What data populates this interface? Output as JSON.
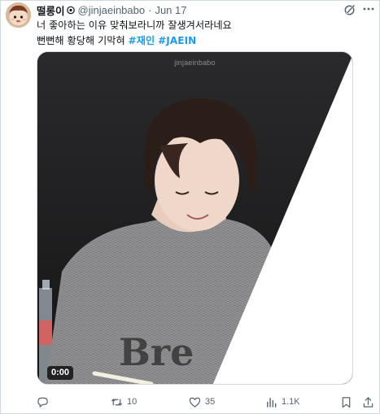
{
  "tweet": {
    "author": {
      "display_name": "떨롱이",
      "name_emoji_icon": "small-spiral-emoji-icon",
      "handle": "@jinjaeinbabo",
      "separator": "·",
      "date": "Jun 17"
    },
    "text_line1": "너 좋아하는 이유 맞춰보라니까 잘생겨서라네요",
    "text_line2_prefix": "뻔뻔해 황당해 기막혀 ",
    "hashtags": [
      "#재인",
      "#JAEIN"
    ],
    "media": {
      "watermark": "jinjaeinbabo",
      "duration": "0:00"
    },
    "actions": {
      "reply": {
        "icon": "reply-icon",
        "count": ""
      },
      "retweet": {
        "icon": "retweet-icon",
        "count": "10"
      },
      "like": {
        "icon": "heart-icon",
        "count": "35"
      },
      "views": {
        "icon": "views-chart-icon",
        "count": "1.1K"
      },
      "bookmark": {
        "icon": "bookmark-icon",
        "count": ""
      },
      "share": {
        "icon": "share-icon",
        "count": ""
      }
    }
  },
  "colors": {
    "text_primary": "#0f1419",
    "text_secondary": "#536471",
    "hashtag": "#1d9bf0",
    "border": "#cfd9de"
  }
}
